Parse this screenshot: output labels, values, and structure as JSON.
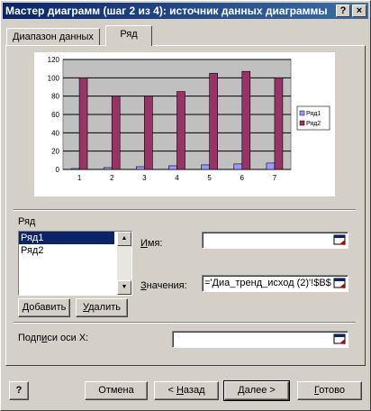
{
  "window": {
    "title": "Мастер диаграмм (шаг 2 из 4): источник данных диаграммы",
    "help_glyph": "?",
    "close_glyph": "×"
  },
  "tabs": [
    {
      "label": "Диапазон данных",
      "active": false
    },
    {
      "label": "Ряд",
      "active": true
    }
  ],
  "chart_data": {
    "type": "bar",
    "categories": [
      "1",
      "2",
      "3",
      "4",
      "5",
      "6",
      "7"
    ],
    "series": [
      {
        "name": "Ряд1",
        "values": [
          1,
          2,
          3,
          4,
          5,
          6,
          7
        ],
        "color": "#9999ff"
      },
      {
        "name": "Ряд2",
        "values": [
          100,
          80,
          80,
          85,
          105,
          107,
          100
        ],
        "color": "#993366"
      }
    ],
    "ylim": [
      0,
      120
    ],
    "yticks": [
      "0",
      "20",
      "40",
      "60",
      "80",
      "100",
      "120"
    ],
    "grid": true,
    "legend": "right"
  },
  "series_section": {
    "label": "Ряд",
    "items": [
      "Ряд1",
      "Ряд2"
    ],
    "selected": 0,
    "add_button": {
      "pre": "",
      "key": "Д",
      "post": "обавить"
    },
    "remove_button": {
      "pre": "",
      "key": "У",
      "post": "далить"
    }
  },
  "name_field": {
    "pre": "",
    "key": "И",
    "post": "мя:",
    "value": ""
  },
  "values_field": {
    "pre": "",
    "key": "З",
    "post": "начения:",
    "value": "='Диа_тренд_исход (2)'!$B$"
  },
  "xaxis_field": {
    "pre": "Подп",
    "key": "и",
    "post": "си оси X:",
    "value": ""
  },
  "buttons": {
    "help_glyph": "?",
    "cancel": "Отмена",
    "back": {
      "pre": "< ",
      "key": "Н",
      "post": "азад"
    },
    "next": {
      "pre": "",
      "key": "Д",
      "post": "алее >"
    },
    "finish": {
      "pre": "",
      "key": "Г",
      "post": "отово"
    }
  }
}
